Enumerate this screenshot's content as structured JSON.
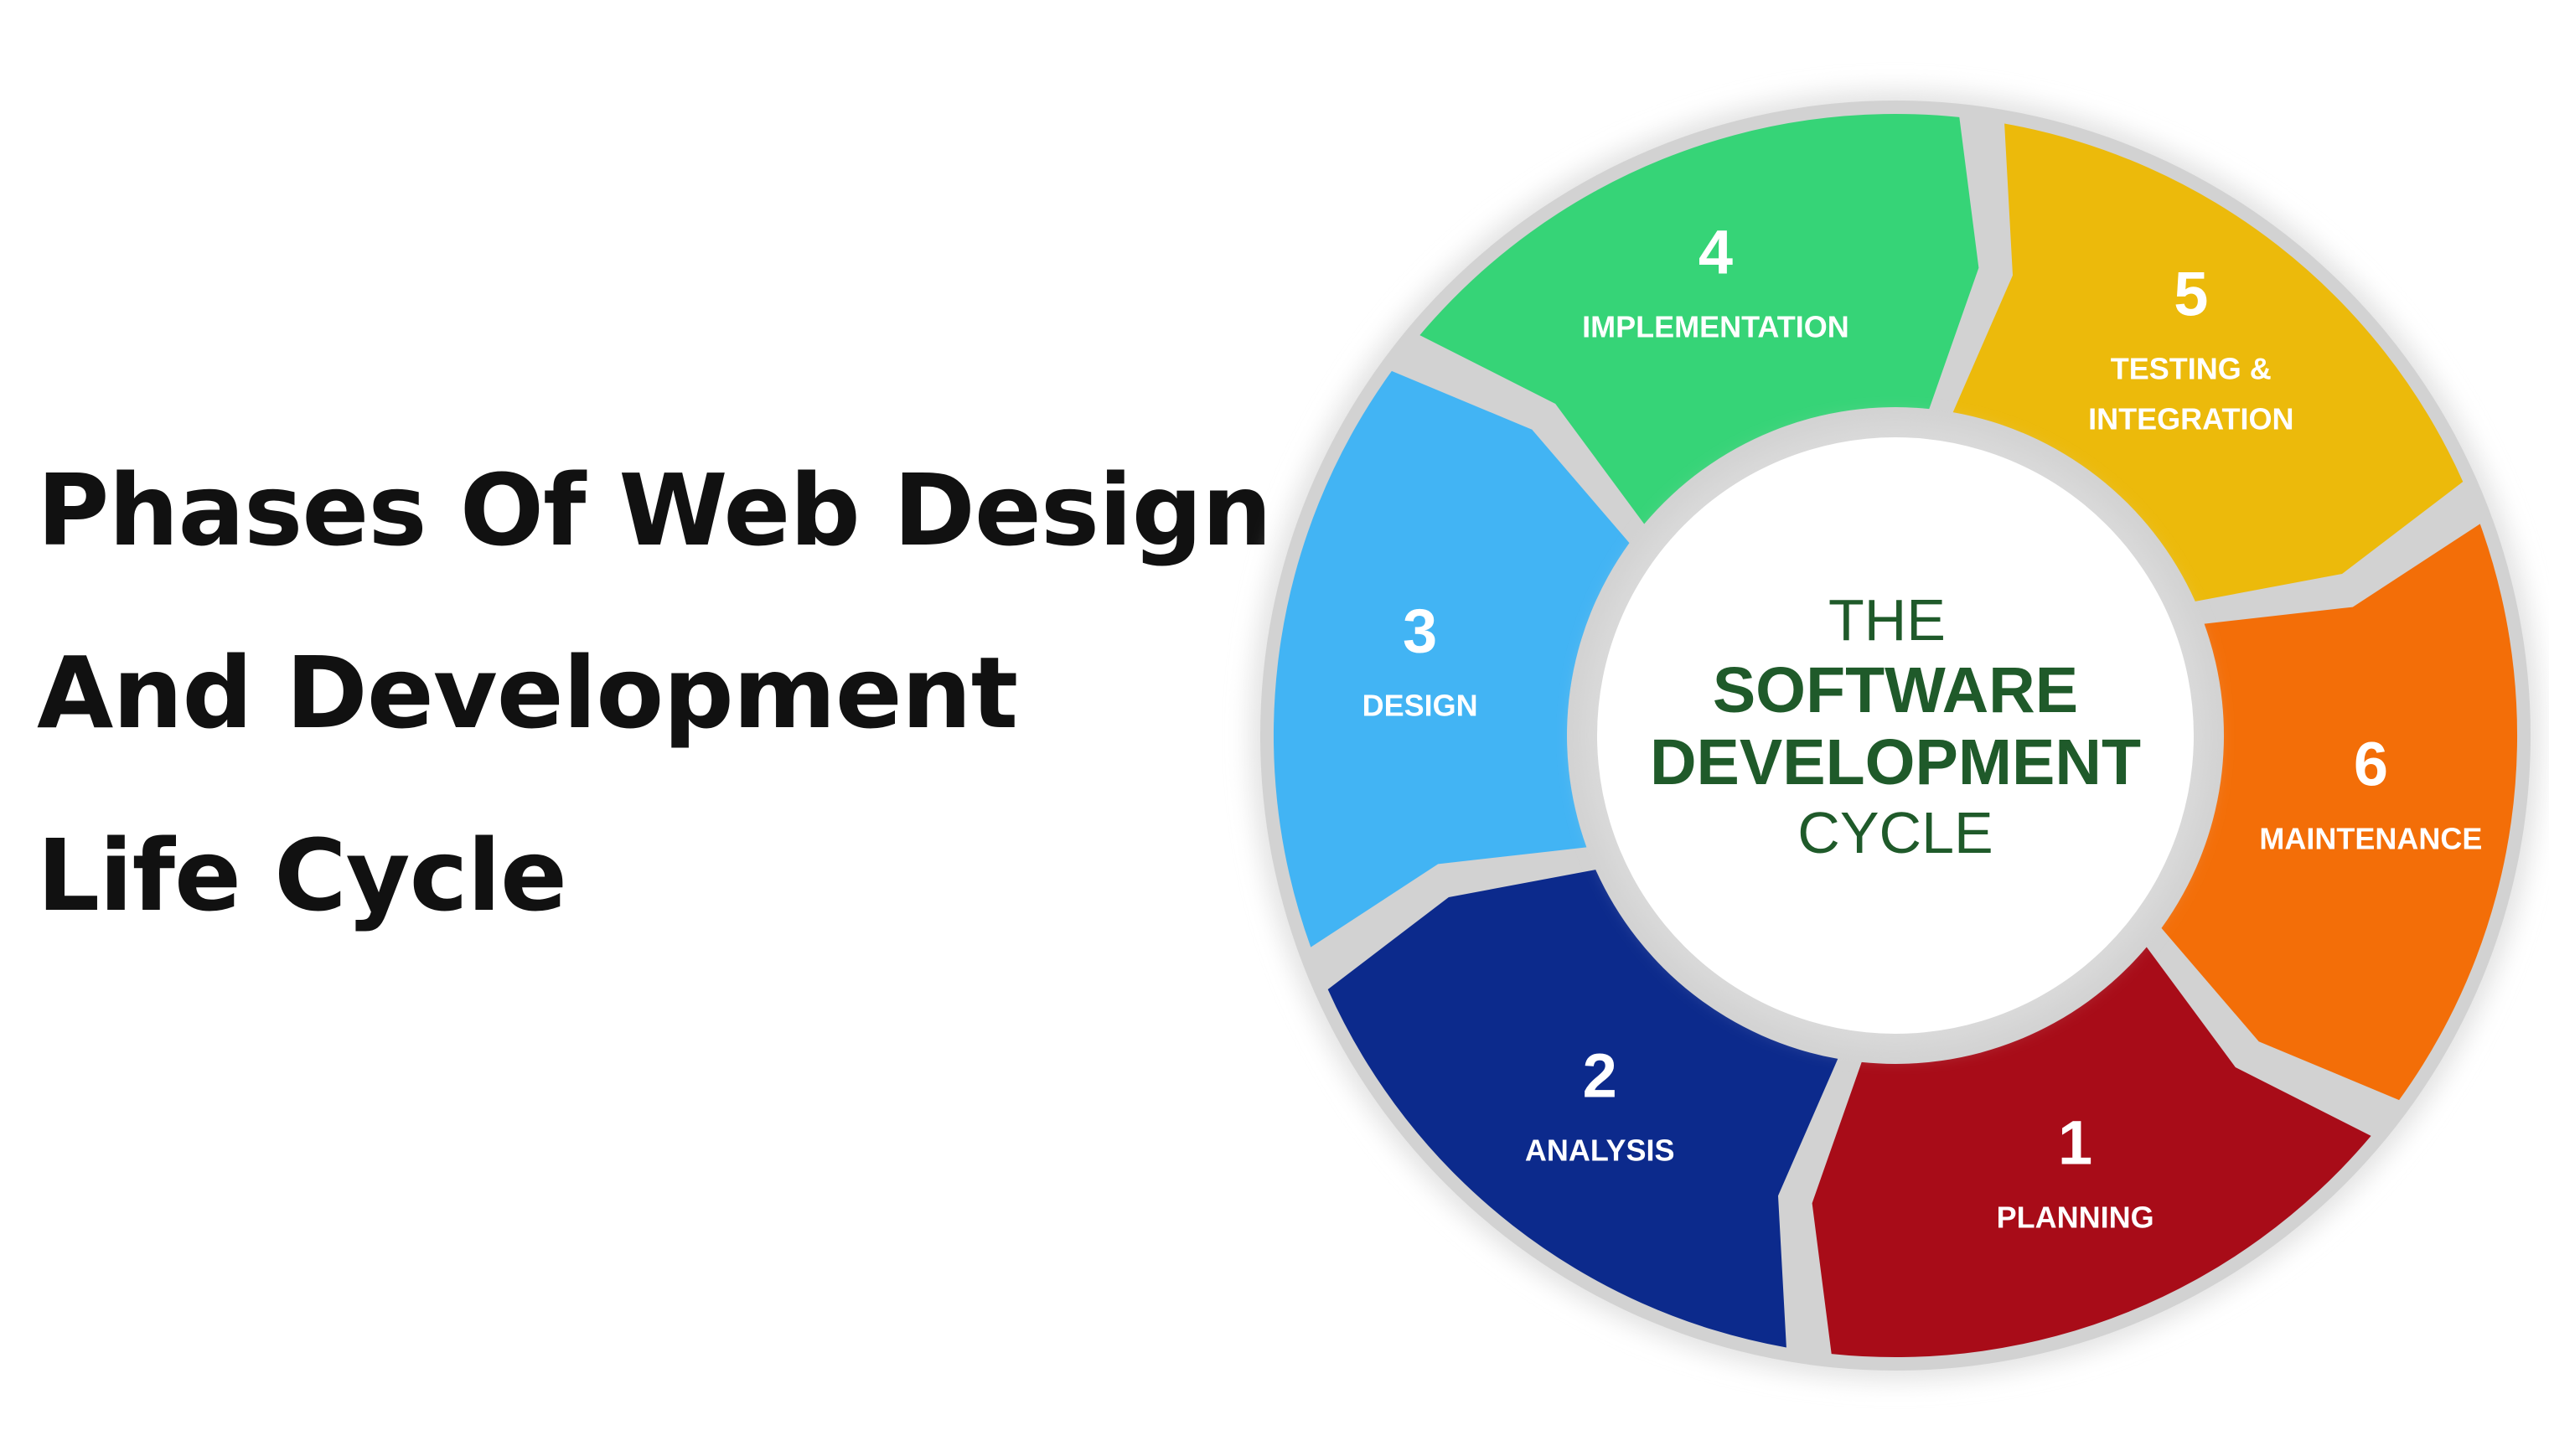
{
  "heading": {
    "lines": [
      "Phases Of Web Design",
      "And Development",
      "Life Cycle"
    ]
  },
  "cycle": {
    "center": {
      "line1": "THE",
      "line2": "SOFTWARE",
      "line3": "DEVELOPMENT",
      "line4": "CYCLE"
    },
    "phases": [
      {
        "number": "1",
        "label_lines": [
          "PLANNING"
        ],
        "color": "#A80C18"
      },
      {
        "number": "2",
        "label_lines": [
          "ANALYSIS"
        ],
        "color": "#0C2A8C"
      },
      {
        "number": "3",
        "label_lines": [
          "DESIGN"
        ],
        "color": "#42B4F4"
      },
      {
        "number": "4",
        "label_lines": [
          "IMPLEMENTATION"
        ],
        "color": "#36D477"
      },
      {
        "number": "5",
        "label_lines": [
          "TESTING &",
          "INTEGRATION"
        ],
        "color": "#ECBA0B"
      },
      {
        "number": "6",
        "label_lines": [
          "MAINTENANCE"
        ],
        "color": "#F36E08"
      }
    ],
    "colors": {
      "ring_border": "#cfcfcf",
      "center_text": "#1f5a2a"
    }
  }
}
